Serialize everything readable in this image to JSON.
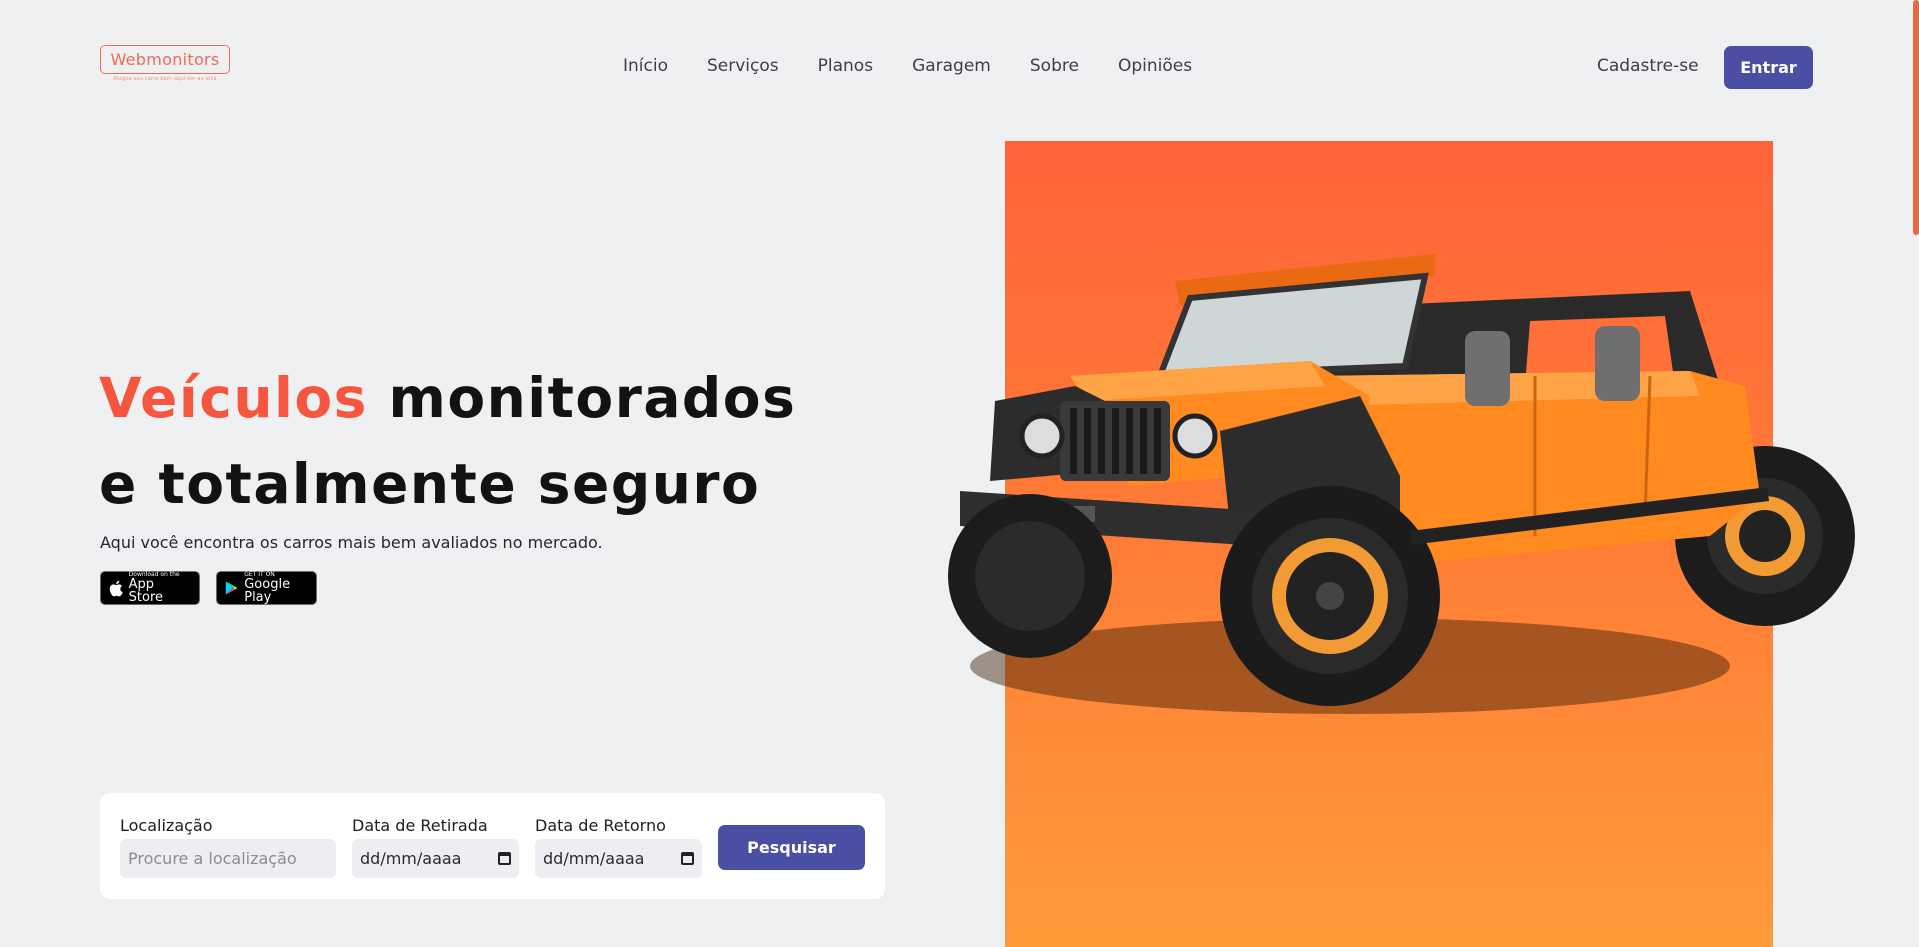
{
  "brand": {
    "name": "Webmonitors",
    "tagline": "Alugue seu carro bem aqui em ao alca"
  },
  "nav": {
    "items": [
      "Início",
      "Serviços",
      "Planos",
      "Garagem",
      "Sobre",
      "Opiniões"
    ],
    "signup_label": "Cadastre-se",
    "login_label": "Entrar"
  },
  "hero": {
    "title_accent": "Veículos",
    "title_rest_line1": "monitorados",
    "title_line2": "e totalmente seguro",
    "subtitle": "Aqui você encontra os carros mais bem avaliados no mercado.",
    "appstore_small": "Download on the",
    "appstore_big": "App Store",
    "googleplay_small": "GET IT ON",
    "googleplay_big": "Google Play"
  },
  "search": {
    "location_label": "Localização",
    "location_placeholder": "Procure a localização",
    "pickup_label": "Data de Retirada",
    "pickup_value": "dd/mm/aaaa",
    "return_label": "Data de Retorno",
    "return_value": "dd/mm/aaaa",
    "button_label": "Pesquisar"
  },
  "colors": {
    "accent": "#f6553f",
    "primary": "#4a4fa3",
    "panel_top": "#ff633a",
    "panel_bottom": "#ff9a3a",
    "jeep_body": "#ff8a1f"
  },
  "icons": {
    "apple": "apple-icon",
    "googleplay": "google-play-icon",
    "calendar": "calendar-icon"
  }
}
